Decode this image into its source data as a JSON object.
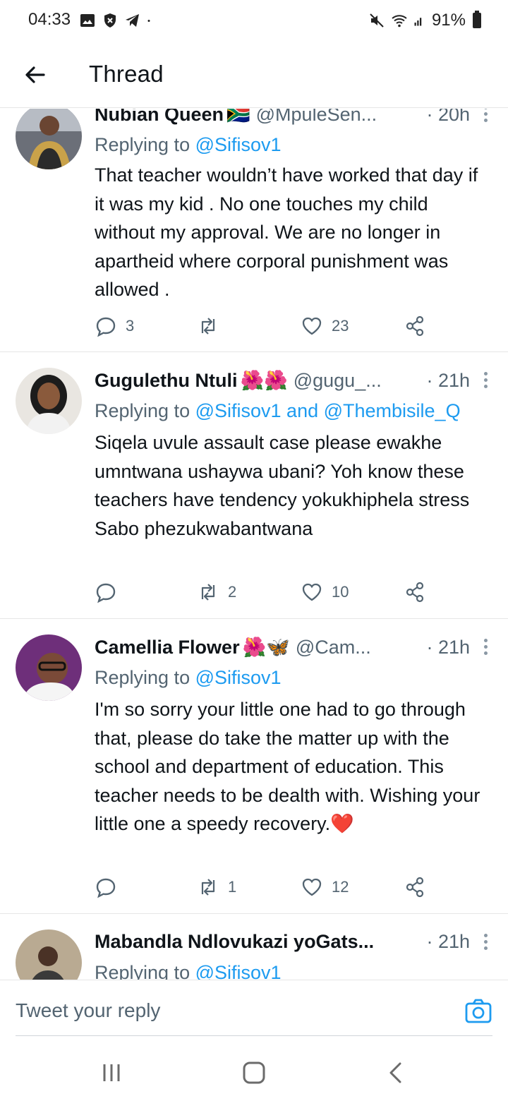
{
  "status_bar": {
    "time": "04:33",
    "battery": "91%",
    "left_icons": [
      "gallery-icon",
      "shield-icon",
      "telegram-icon",
      "dot-icon"
    ],
    "right_icons": [
      "mute-icon",
      "wifi-icon",
      "signal-icon",
      "battery-icon"
    ]
  },
  "header": {
    "title": "Thread",
    "back_icon": "arrow-left-icon"
  },
  "tweets": [
    {
      "name": "Nubian Queen",
      "emoji": "🇿🇦",
      "handle": "@MpuleSen...",
      "time": "· 20h",
      "replying_prefix": "Replying to ",
      "replying_to": "@Sifisov1",
      "replying_and": "",
      "replying_to_2": "",
      "text": "That teacher wouldn’t have worked that day if it was my kid . No one touches my child without my approval. We are no longer in apartheid where corporal punishment was allowed .",
      "replies": "3",
      "retweets": "",
      "likes": "23"
    },
    {
      "name": "Gugulethu Ntuli",
      "emoji": "🌺🌺",
      "handle": "@gugu_...",
      "time": "· 21h",
      "replying_prefix": "Replying to ",
      "replying_to": "@Sifisov1",
      "replying_and": " and ",
      "replying_to_2": "@Thembisile_Q",
      "text": "Siqela uvule assault case please ewakhe umntwana ushaywa ubani? Yoh know these teachers have tendency yokukhiphela stress Sabo phezukwabantwana",
      "replies": "",
      "retweets": "2",
      "likes": "10"
    },
    {
      "name": "Camellia Flower",
      "emoji": "🌺🦋",
      "handle": "@Cam...",
      "time": "· 21h",
      "replying_prefix": "Replying to ",
      "replying_to": "@Sifisov1",
      "replying_and": "",
      "replying_to_2": "",
      "text": "I'm so sorry your little one had to go through that, please do take the matter up with the school and department of education. This teacher needs to be dealth with. Wishing your little one a speedy recovery.❤️",
      "replies": "",
      "retweets": "1",
      "likes": "12"
    },
    {
      "name": "Mabandla Ndlovukazi yoGats...",
      "emoji": "",
      "handle": "",
      "time": "· 21h",
      "replying_prefix": "Replying to ",
      "replying_to": "@Sifisov1",
      "replying_and": "",
      "replying_to_2": "",
      "text": "",
      "replies": "",
      "retweets": "",
      "likes": ""
    }
  ],
  "reply_bar": {
    "placeholder": "Tweet your reply",
    "camera_icon": "camera-icon"
  },
  "nav_bar": {
    "buttons": [
      "recent-apps-icon",
      "home-icon",
      "back-icon"
    ]
  },
  "colors": {
    "accent": "#1d9bf0",
    "secondary_text": "#536471",
    "divider": "#e6e6e6"
  }
}
